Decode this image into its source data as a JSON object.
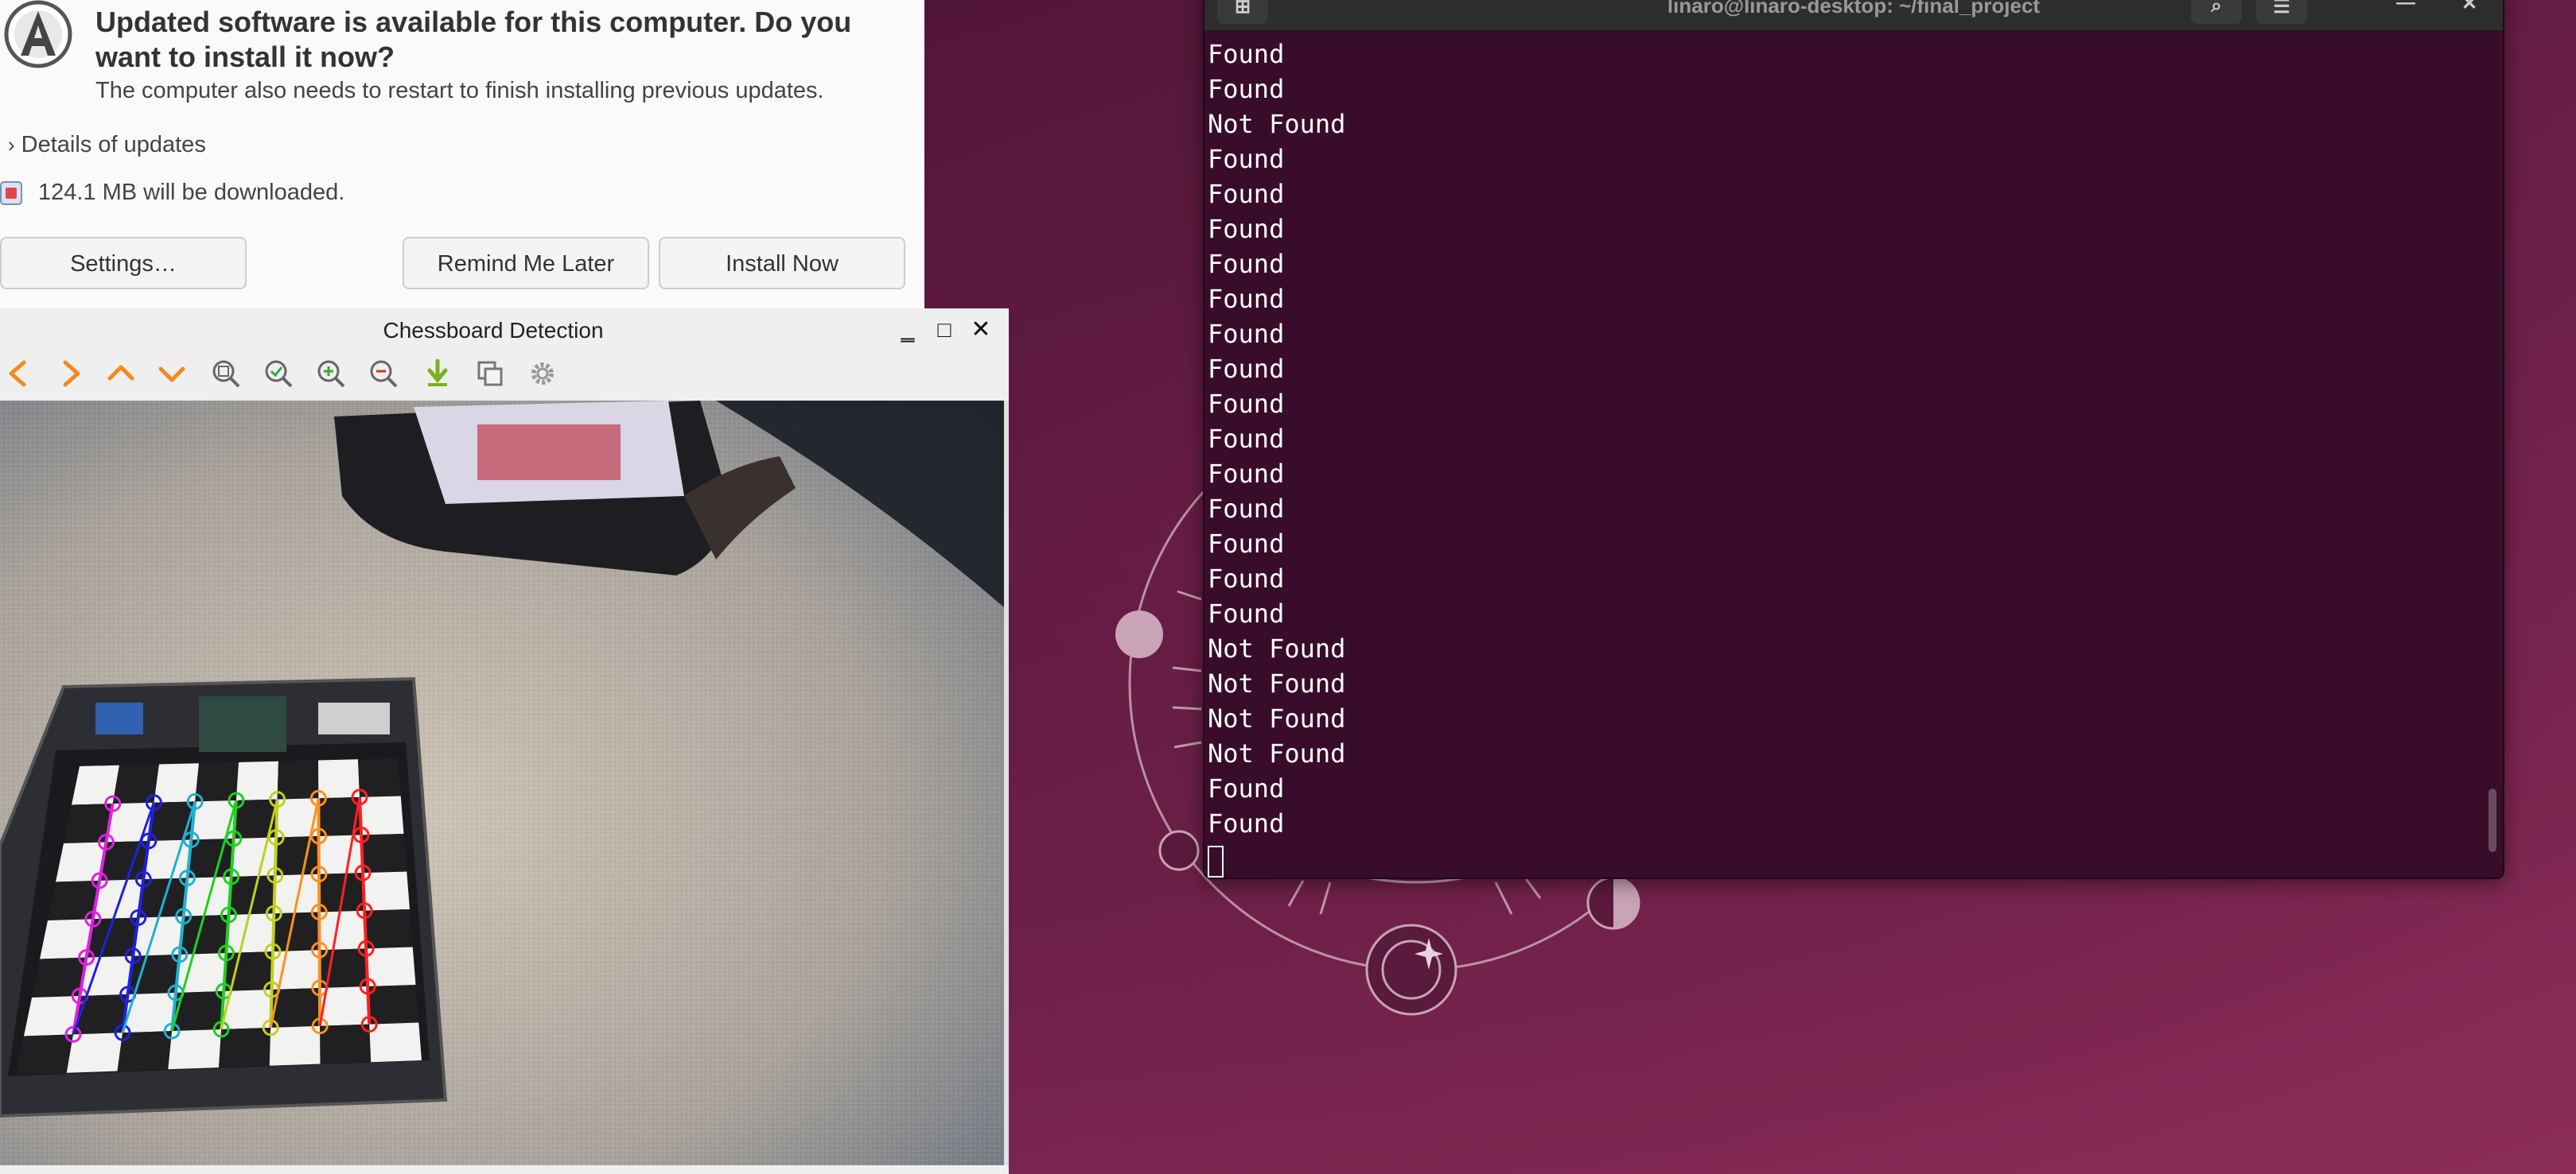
{
  "desktop": {
    "wallpaper_colors": [
      "#4a1233",
      "#7a2550",
      "#8b2c58"
    ]
  },
  "terminal": {
    "title": "linaro@linaro-desktop: ~/final_project",
    "background": "#380c2a",
    "lines": [
      "Found",
      "Found",
      "Not Found",
      "Found",
      "Found",
      "Found",
      "Found",
      "Found",
      "Found",
      "Found",
      "Found",
      "Found",
      "Found",
      "Found",
      "Found",
      "Found",
      "Found",
      "Not Found",
      "Not Found",
      "Not Found",
      "Not Found",
      "Found",
      "Found"
    ],
    "icons": [
      "terminal-new-tab-icon",
      "search-icon",
      "menu-icon",
      "minimize-icon",
      "close-icon"
    ]
  },
  "updater": {
    "heading": "Updated software is available for this computer. Do you want to install it now?",
    "subtext": "The computer also needs to restart to finish installing previous updates.",
    "details_label": "Details of updates",
    "download_size": "124.1 MB will be downloaded.",
    "buttons": {
      "settings": "Settings…",
      "remind_later": "Remind Me Later",
      "install_now": "Install Now"
    }
  },
  "chess_window": {
    "title": "Chessboard Detection",
    "toolbar_icons": [
      "arrow-left-icon",
      "arrow-right-icon",
      "arrow-up-icon",
      "arrow-down-icon",
      "zoom-fit-icon",
      "zoom-original-icon",
      "zoom-in-icon",
      "zoom-out-icon",
      "save-icon",
      "copy-icon",
      "settings-icon"
    ],
    "corner_colors": [
      "#e020e0",
      "#2020e0",
      "#20b0d0",
      "#20d020",
      "#c0d020",
      "#ff9020",
      "#ff2020"
    ]
  }
}
